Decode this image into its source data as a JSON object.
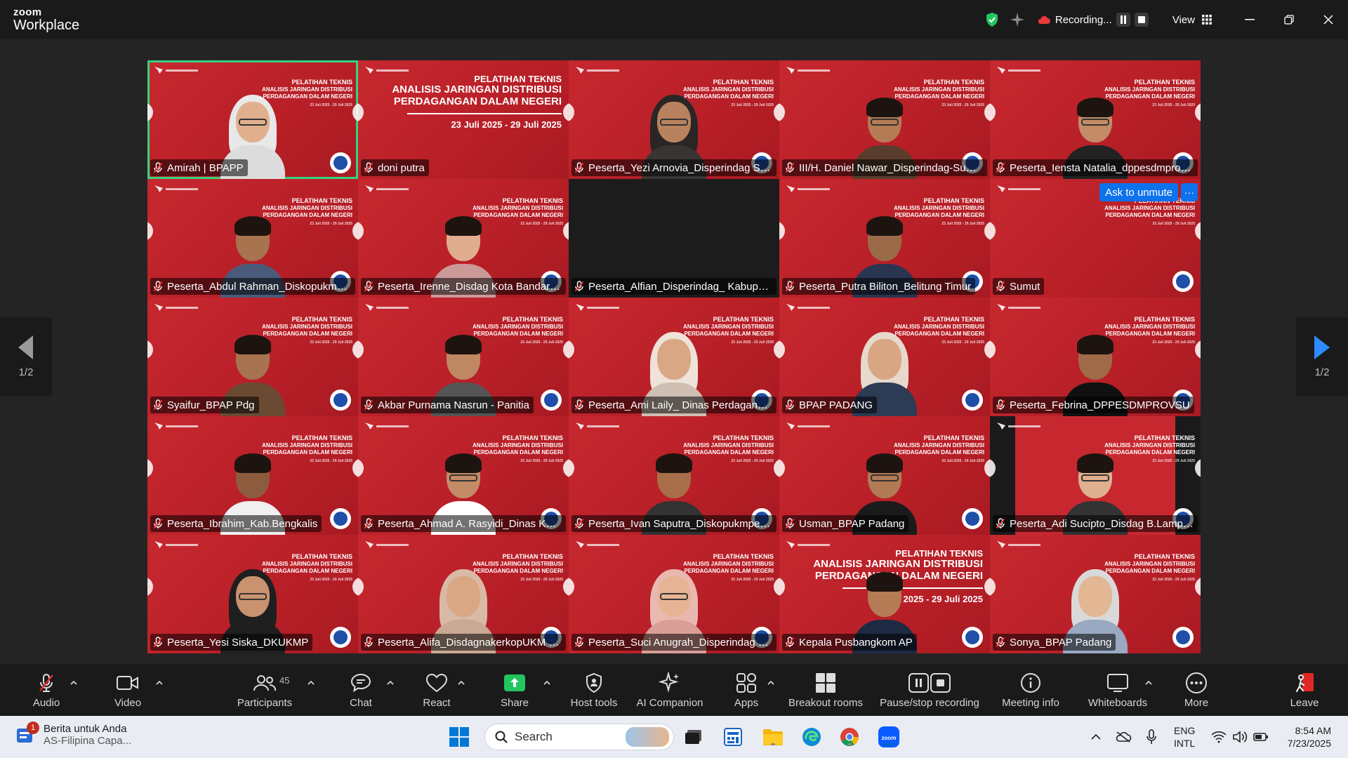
{
  "app": {
    "brand_small": "zoom",
    "brand_large": "Workplace"
  },
  "titlebar": {
    "recording_label": "Recording...",
    "view_label": "View"
  },
  "banner": {
    "line1": "PELATIHAN TEKNIS",
    "line2a": "ANALISIS JARINGAN DISTRIBUSI",
    "line2b": "PERDAGANGAN DALAM NEGERI",
    "dates": "23 Juli 2025 - 29 Juli 2025",
    "dates_partial": "2025 - 29 Juli 2025"
  },
  "colors": {
    "tile_red": "#c7282f",
    "active_border": "#37d27e",
    "accent_blue": "#0e72ed",
    "taskbar": "#e9edf3"
  },
  "tiles": [
    {
      "name": "Amirah | BPAPP"
    },
    {
      "name": "doni putra"
    },
    {
      "name": "Peserta_Yezi Arnovia_Disperindag Su..."
    },
    {
      "name": "III/H. Daniel Nawar_Disperindag-Sum..."
    },
    {
      "name": "Peserta_Iensta Natalia_dppesdmprov..."
    },
    {
      "name": "Peserta_Abdul Rahman_Diskopukmp..."
    },
    {
      "name": "Peserta_Irenne_Disdag Kota Bandar L..."
    },
    {
      "name": "Peserta_Alfian_Disperindag_ Kabupat..."
    },
    {
      "name": "Peserta_Putra Biliton_Belitung Timur"
    },
    {
      "name": "Sumut",
      "ask_label": "Ask to unmute",
      "more_label": "···"
    },
    {
      "name": "Syaifur_BPAP Pdg"
    },
    {
      "name": "Akbar Purnama Nasrun - Panitia"
    },
    {
      "name": "Peserta_Ami Laily_ Dinas Perdaganga..."
    },
    {
      "name": "BPAP PADANG"
    },
    {
      "name": "Peserta_Febrina_DPPESDMPROVSU"
    },
    {
      "name": "Peserta_Ibrahim_Kab.Bengkalis"
    },
    {
      "name": "Peserta_Ahmad A. Rasyidi_Dinas KUK..."
    },
    {
      "name": "Peserta_Ivan Saputra_Diskopukmperi..."
    },
    {
      "name": "Usman_BPAP Padang"
    },
    {
      "name": "Peserta_Adi Sucipto_Disdag B.Lampu..."
    },
    {
      "name": "Peserta_Yesi Siska_DKUKMP"
    },
    {
      "name": "Peserta_Alifa_DisdagnakerkopUKM K..."
    },
    {
      "name": "Peserta_Suci Anugrah_Disperindag S..."
    },
    {
      "name": "Kepala Pusbangkom AP"
    },
    {
      "name": "Sonya_BPAP Padang"
    }
  ],
  "pager": {
    "left": "1/2",
    "right": "1/2"
  },
  "toolbar": {
    "audio": "Audio",
    "video": "Video",
    "participants": "Participants",
    "participants_count": "45",
    "chat": "Chat",
    "react": "React",
    "share": "Share",
    "host_tools": "Host tools",
    "ai_companion": "AI Companion",
    "apps": "Apps",
    "breakout": "Breakout rooms",
    "pause_stop": "Pause/stop recording",
    "meeting_info": "Meeting info",
    "whiteboards": "Whiteboards",
    "more": "More",
    "leave": "Leave"
  },
  "taskbar": {
    "news_title": "Berita untuk Anda",
    "news_sub": "AS-Filipina Capa...",
    "news_badge": "1",
    "search_placeholder": "Search",
    "lang_top": "ENG",
    "lang_bottom": "INTL",
    "time": "8:54 AM",
    "date": "7/23/2025"
  }
}
